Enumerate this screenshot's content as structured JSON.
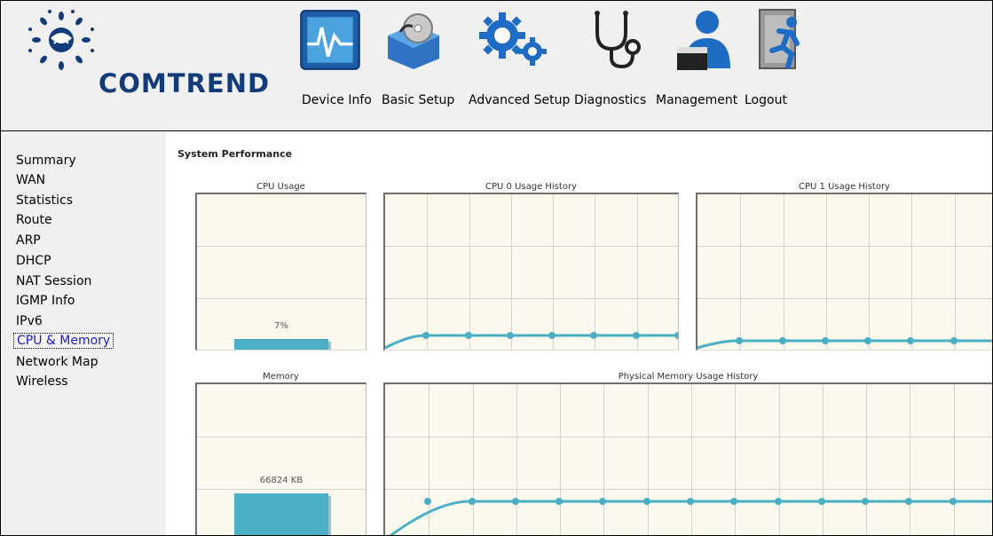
{
  "header": {
    "brand": "COMTREND",
    "nav": [
      {
        "label": "Device Info",
        "icon": "device-info-icon"
      },
      {
        "label": "Basic Setup",
        "icon": "basic-setup-icon"
      },
      {
        "label": "Advanced Setup",
        "icon": "advanced-setup-icon"
      },
      {
        "label": "Diagnostics",
        "icon": "diagnostics-icon"
      },
      {
        "label": "Management",
        "icon": "management-icon"
      },
      {
        "label": "Logout",
        "icon": "logout-icon"
      }
    ]
  },
  "sidebar": {
    "items": [
      {
        "label": "Summary"
      },
      {
        "label": "WAN"
      },
      {
        "label": "Statistics"
      },
      {
        "label": "Route"
      },
      {
        "label": "ARP"
      },
      {
        "label": "DHCP"
      },
      {
        "label": "NAT Session"
      },
      {
        "label": "IGMP Info"
      },
      {
        "label": "IPv6"
      },
      {
        "label": "CPU & Memory",
        "active": true
      },
      {
        "label": "Network Map"
      },
      {
        "label": "Wireless"
      }
    ],
    "active_color": "#1a1ad0"
  },
  "main": {
    "section_title": "System Performance",
    "cpu_usage": {
      "title": "CPU Usage",
      "value_label": "7%",
      "percent": 7
    },
    "cpu0_history": {
      "title": "CPU 0 Usage History"
    },
    "cpu1_history": {
      "title": "CPU 1 Usage History"
    },
    "memory": {
      "title": "Memory",
      "value_label": "66824 KB",
      "fill_fraction": 0.72
    },
    "memory_history": {
      "title": "Physical Memory Usage History"
    }
  },
  "colors": {
    "accent": "#4aaec4",
    "panel_bg": "#fbf8ee",
    "grid": "#d4d4d4",
    "brand": "#123b7a"
  }
}
